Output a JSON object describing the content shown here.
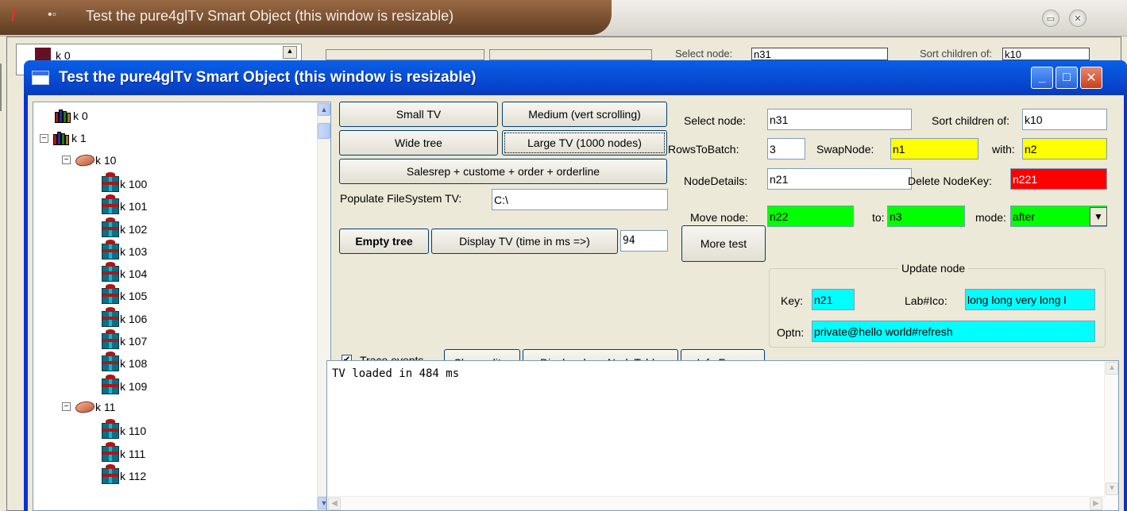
{
  "background_window": {
    "title": "Test the pure4glTv Smart Object  (this window is resizable)",
    "tree_first": "k 0",
    "select_label": "Select node:",
    "select_value": "n31",
    "sort_label": "Sort children of:",
    "sort_value": "k10"
  },
  "window": {
    "title": "Test the pure4glTv Smart Object  (this window is resizable)",
    "controls": {
      "minimize": "_",
      "maximize": "□",
      "close": "✕"
    }
  },
  "tree": {
    "nodes": [
      {
        "label": "k 0",
        "icon": "books-icon",
        "expander": ""
      },
      {
        "label": "k 1",
        "icon": "books-icon",
        "expander": "⊟"
      },
      {
        "label": "k 10",
        "icon": "book-icon",
        "expander": "⊟"
      },
      {
        "label": "k 100",
        "icon": "gift-icon",
        "expander": ""
      },
      {
        "label": "k 101",
        "icon": "gift-icon",
        "expander": ""
      },
      {
        "label": "k 102",
        "icon": "gift-icon",
        "expander": ""
      },
      {
        "label": "k 103",
        "icon": "gift-icon",
        "expander": ""
      },
      {
        "label": "k 104",
        "icon": "gift-icon",
        "expander": ""
      },
      {
        "label": "k 105",
        "icon": "gift-icon",
        "expander": ""
      },
      {
        "label": "k 106",
        "icon": "gift-icon",
        "expander": ""
      },
      {
        "label": "k 107",
        "icon": "gift-icon",
        "expander": ""
      },
      {
        "label": "k 108",
        "icon": "gift-icon",
        "expander": ""
      },
      {
        "label": "k 109",
        "icon": "gift-icon",
        "expander": ""
      },
      {
        "label": "k 11",
        "icon": "book-icon",
        "expander": "⊟"
      },
      {
        "label": "k 110",
        "icon": "gift-icon",
        "expander": ""
      },
      {
        "label": "k 111",
        "icon": "gift-icon",
        "expander": ""
      },
      {
        "label": "k 112",
        "icon": "gift-icon",
        "expander": ""
      }
    ]
  },
  "buttons": {
    "small_tv": "Small TV",
    "medium": "Medium (vert scrolling)",
    "wide_tree": "Wide tree",
    "large_tv": "Large TV (1000 nodes)",
    "salesrep": "Salesrep + custome + order + orderline",
    "empty_tree": "Empty tree",
    "display_tv": "Display TV  (time in ms =>)",
    "more_test": "More test",
    "clear_editor": "Clear editor",
    "display_dump": "Display dumpNodeTable",
    "info_focus": "Info Focus"
  },
  "fields": {
    "populate_label": "Populate FileSystem TV:",
    "populate_value": "C:\\",
    "display_ms_value": "94",
    "trace_label": "Trace events",
    "trace_checked": "✔",
    "select_label": "Select node:",
    "select_value": "n31",
    "sort_label": "Sort children of:",
    "sort_value": "k10",
    "rows_label": "RowsToBatch:",
    "rows_value": "3",
    "swap_label": "SwapNode:",
    "swap_value": "n1",
    "with_label": "with:",
    "with_value": "n2",
    "details_label": "NodeDetails:",
    "details_value": "n21",
    "delete_label": "Delete NodeKey:",
    "delete_value": "n221",
    "move_label": "Move node:",
    "move_value": "n22",
    "to_label": "to:",
    "to_value": "n3",
    "mode_label": "mode:",
    "mode_value": "after"
  },
  "update_node": {
    "title": "Update node",
    "key_label": "Key:",
    "key_value": "n21",
    "labico_label": "Lab#Ico:",
    "labico_value": "long long very long l",
    "optn_label": "Optn:",
    "optn_value": "private@hello world#refresh"
  },
  "editor": {
    "text": "TV loaded in 484 ms"
  },
  "colors": {
    "yellow": "#ffff00",
    "red": "#ff0000",
    "green": "#00ff00",
    "cyan": "#00ffff",
    "xp_blue": "#0851d9"
  }
}
